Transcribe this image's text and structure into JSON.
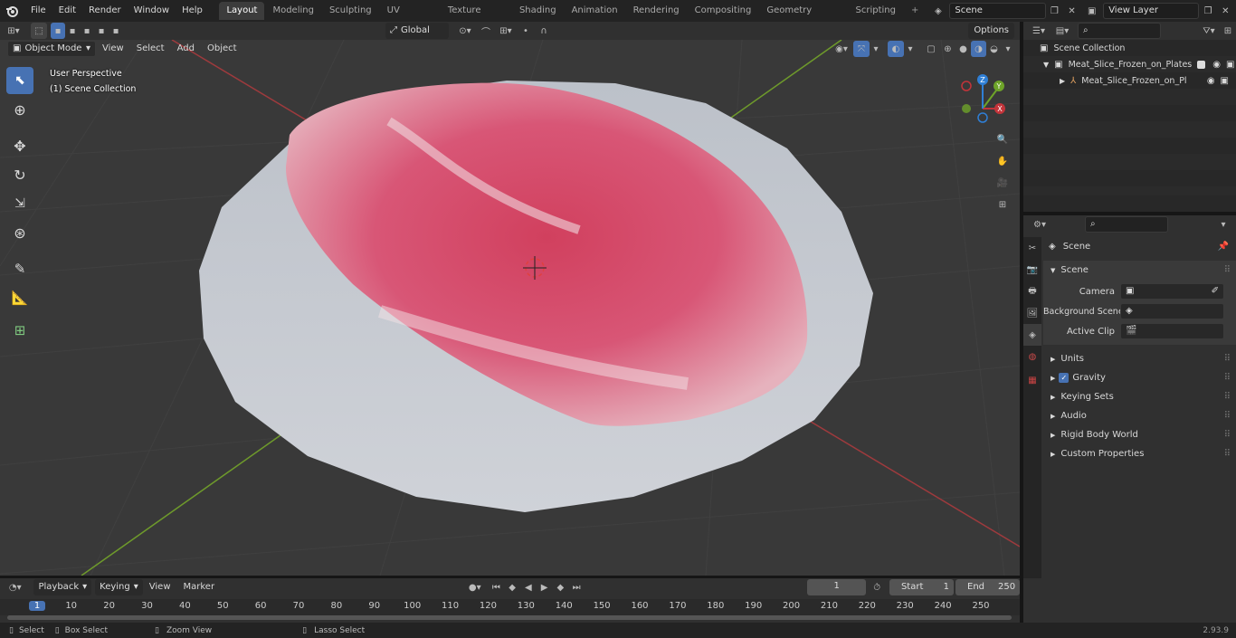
{
  "topbar": {
    "menus": [
      "File",
      "Edit",
      "Render",
      "Window",
      "Help"
    ],
    "workspaces": [
      "Layout",
      "Modeling",
      "Sculpting",
      "UV Editing",
      "Texture Paint",
      "Shading",
      "Animation",
      "Rendering",
      "Compositing",
      "Geometry Nodes",
      "Scripting"
    ],
    "active_workspace": "Layout",
    "scene": "Scene",
    "view_layer": "View Layer"
  },
  "viewport_header": {
    "mode": "Object Mode",
    "menus": [
      "View",
      "Select",
      "Add",
      "Object"
    ],
    "orientation": "Global",
    "options": "Options"
  },
  "viewport": {
    "overlay_line1": "User Perspective",
    "overlay_line2": "(1) Scene Collection"
  },
  "outliner": {
    "root": "Scene Collection",
    "collection": "Meat_Slice_Frozen_on_Plates",
    "object": "Meat_Slice_Frozen_on_Pl"
  },
  "properties": {
    "context": "Scene",
    "section": "Scene",
    "fields": [
      {
        "label": "Camera",
        "value": ""
      },
      {
        "label": "Background Scene",
        "value": ""
      },
      {
        "label": "Active Clip",
        "value": ""
      }
    ],
    "subpanels": [
      "Units",
      "Gravity",
      "Keying Sets",
      "Audio",
      "Rigid Body World",
      "Custom Properties"
    ]
  },
  "timeline": {
    "menus": [
      "Playback",
      "Keying",
      "View",
      "Marker"
    ],
    "current_frame": "1",
    "start_label": "Start",
    "start": "1",
    "end_label": "End",
    "end": "250",
    "ruler": [
      "1",
      "10",
      "20",
      "30",
      "40",
      "50",
      "60",
      "70",
      "80",
      "90",
      "100",
      "110",
      "120",
      "130",
      "140",
      "150",
      "160",
      "170",
      "180",
      "190",
      "200",
      "210",
      "220",
      "230",
      "240",
      "250"
    ]
  },
  "statusbar": {
    "select": "Select",
    "box_select": "Box Select",
    "zoom_view": "Zoom View",
    "lasso_select": "Lasso Select",
    "version": "2.93.9"
  },
  "colors": {
    "accent": "#4772b3",
    "x_axis": "#c3343a",
    "y_axis": "#6ea329",
    "z_axis": "#2f7fd6"
  }
}
